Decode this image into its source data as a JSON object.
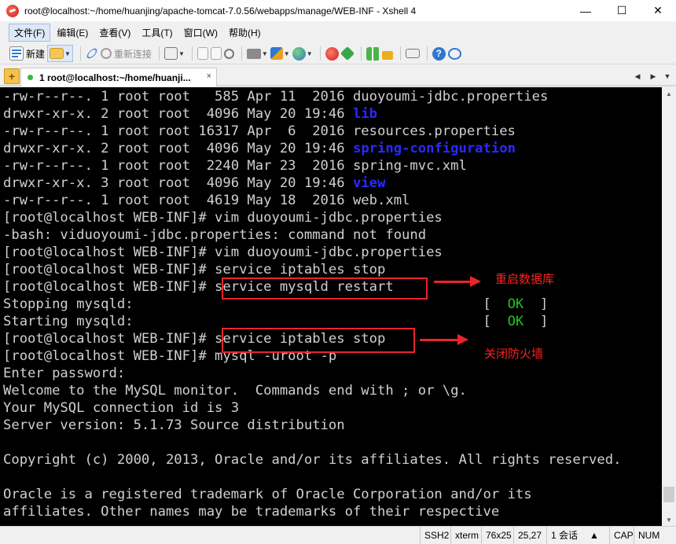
{
  "window": {
    "title": "root@localhost:~/home/huanjing/apache-tomcat-7.0.56/webapps/manage/WEB-INF - Xshell 4",
    "minimize": "—",
    "maximize": "☐",
    "close": "✕"
  },
  "menu": [
    "文件(F)",
    "编辑(E)",
    "查看(V)",
    "工具(T)",
    "窗口(W)",
    "帮助(H)"
  ],
  "toolbar": {
    "new_label": "新建",
    "reconnect_label": "重新连接"
  },
  "tab": {
    "add": "+",
    "label": "1 root@localhost:~/home/huanji...",
    "close": "×",
    "prev": "◀",
    "next": "▶",
    "menu": "▼"
  },
  "terminal": {
    "lines": [
      {
        "plain": "-rw-r--r--. 1 root root   585 Apr 11  2016 duoyoumi-jdbc.properties",
        "colored": ""
      },
      {
        "plain": "drwxr-xr-x. 2 root root  4096 May 20 19:46 ",
        "colored": "lib"
      },
      {
        "plain": "-rw-r--r--. 1 root root 16317 Apr  6  2016 resources.properties",
        "colored": ""
      },
      {
        "plain": "drwxr-xr-x. 2 root root  4096 May 20 19:46 ",
        "colored": "spring-configuration"
      },
      {
        "plain": "-rw-r--r--. 1 root root  2240 Mar 23  2016 spring-mvc.xml",
        "colored": ""
      },
      {
        "plain": "drwxr-xr-x. 3 root root  4096 May 20 19:46 ",
        "colored": "view"
      },
      {
        "plain": "-rw-r--r--. 1 root root  4619 May 18  2016 web.xml",
        "colored": ""
      },
      {
        "plain": "[root@localhost WEB-INF]# vim duoyoumi-jdbc.properties",
        "colored": ""
      },
      {
        "plain": "-bash: viduoyoumi-jdbc.properties: command not found",
        "colored": ""
      },
      {
        "plain": "[root@localhost WEB-INF]# vim duoyoumi-jdbc.properties",
        "colored": ""
      },
      {
        "plain": "[root@localhost WEB-INF]# service iptables stop",
        "colored": ""
      },
      {
        "plain": "[root@localhost WEB-INF]# service mysqld restart",
        "colored": ""
      },
      {
        "plain": "Stopping mysqld:                                           [  ",
        "colored": "OK",
        "tail": "  ]"
      },
      {
        "plain": "Starting mysqld:                                           [  ",
        "colored": "OK",
        "tail": "  ]"
      },
      {
        "plain": "[root@localhost WEB-INF]# service iptables stop",
        "colored": ""
      },
      {
        "plain": "[root@localhost WEB-INF]# mysql -uroot -p",
        "colored": ""
      },
      {
        "plain": "Enter password:",
        "colored": ""
      },
      {
        "plain": "Welcome to the MySQL monitor.  Commands end with ; or \\g.",
        "colored": ""
      },
      {
        "plain": "Your MySQL connection id is 3",
        "colored": ""
      },
      {
        "plain": "Server version: 5.1.73 Source distribution",
        "colored": ""
      },
      {
        "plain": "",
        "colored": ""
      },
      {
        "plain": "Copyright (c) 2000, 2013, Oracle and/or its affiliates. All rights reserved.",
        "colored": ""
      },
      {
        "plain": "",
        "colored": ""
      },
      {
        "plain": "Oracle is a registered trademark of Oracle Corporation and/or its",
        "colored": ""
      },
      {
        "plain": "affiliates. Other names may be trademarks of their respective",
        "colored": ""
      }
    ]
  },
  "annotations": {
    "restart_db": "重启数据库",
    "close_firewall": "关闭防火墙"
  },
  "status": {
    "protocol": "SSH2",
    "term_type": "xterm",
    "size": "76x25",
    "cursor": "25,27",
    "sessions": "1 会话",
    "caps": "CAP",
    "num": "NUM"
  },
  "colors": {
    "terminal_bg": "#000000",
    "terminal_fg": "#d0d0d0",
    "dir_blue": "#2a2aff",
    "ok_green": "#22c322",
    "annotation_red": "#e8262a"
  }
}
